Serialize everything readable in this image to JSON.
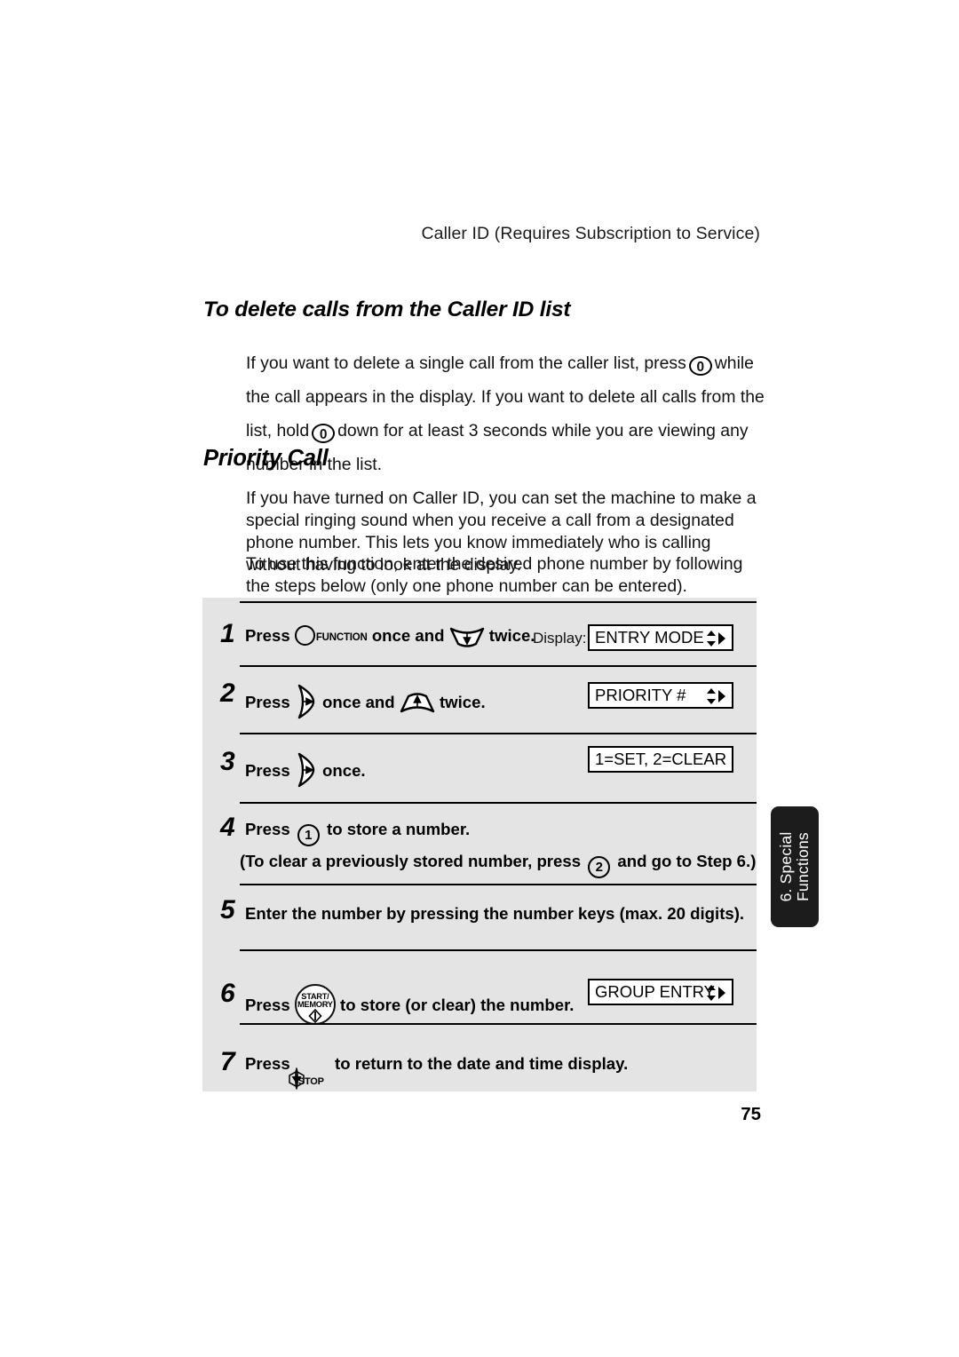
{
  "page": {
    "running_head": "Caller ID (Requires Subscription to Service)",
    "page_number": "75"
  },
  "sections": {
    "delete_calls": {
      "heading": "To delete calls from the Caller ID list",
      "paragraph_part1": "If you want to delete a single call from the caller list, press",
      "key1": "0",
      "paragraph_part2": "while the call appears in the display. If you want to delete all calls from the list, hold",
      "key2": "0",
      "paragraph_part3": "down for at least 3 seconds while you are viewing any number in the list."
    },
    "priority_call": {
      "heading": "Priority Call",
      "paragraph1": "If you have turned on Caller ID, you can set the machine to make a special ringing sound when you receive a call from a designated phone number. This lets you know immediately who is calling without having to look at the display.",
      "paragraph2": "To use this function, enter the desired phone number by following the steps below (only one phone number can be entered)."
    }
  },
  "steps": [
    {
      "number": "1",
      "press_label": "Press",
      "icon1": "function-round-key",
      "icon1_label": "FUNCTION",
      "mid_text": "once and",
      "icon2": "down-arrow-fan-key",
      "end_text": "twice.",
      "display_label": "Display:",
      "display_value": "ENTRY MODE",
      "display_arrows": "up-down-right-arrows"
    },
    {
      "number": "2",
      "press_label": "Press",
      "icon1": "right-arrow-crescent-key",
      "mid_text": "once and",
      "icon2": "up-arrow-fan-key",
      "end_text": "twice.",
      "display_value": "PRIORITY #",
      "display_arrows": "up-down-right-arrows"
    },
    {
      "number": "3",
      "press_label": "Press",
      "icon1": "right-arrow-crescent-key",
      "end_text": "once.",
      "display_value": "1=SET, 2=CLEAR",
      "display_arrows": "none"
    },
    {
      "number": "4",
      "press_label": "Press",
      "key": "1",
      "end_text": "to store a number.",
      "sub_text_part1": "(To clear a previously stored number, press",
      "sub_key": "2",
      "sub_text_part2": "and go to Step 6.)"
    },
    {
      "number": "5",
      "text": "Enter the number by pressing the number keys (max. 20 digits)."
    },
    {
      "number": "6",
      "press_label": "Press",
      "icon1": "start-memory-button",
      "icon1_line1": "START/",
      "icon1_line2": "MEMORY",
      "end_text": "to store (or clear) the number.",
      "display_value": "GROUP ENTRY",
      "display_arrows": "up-down-right-arrows"
    },
    {
      "number": "7",
      "press_label": "Press",
      "icon1": "stop-button",
      "icon1_label": "STOP",
      "end_text": "to return to the date and time display."
    }
  ],
  "side_tab": {
    "line1": "6. Special",
    "line2": "Functions",
    "background": "#1c1c1c",
    "text_color": "#ffffff"
  }
}
